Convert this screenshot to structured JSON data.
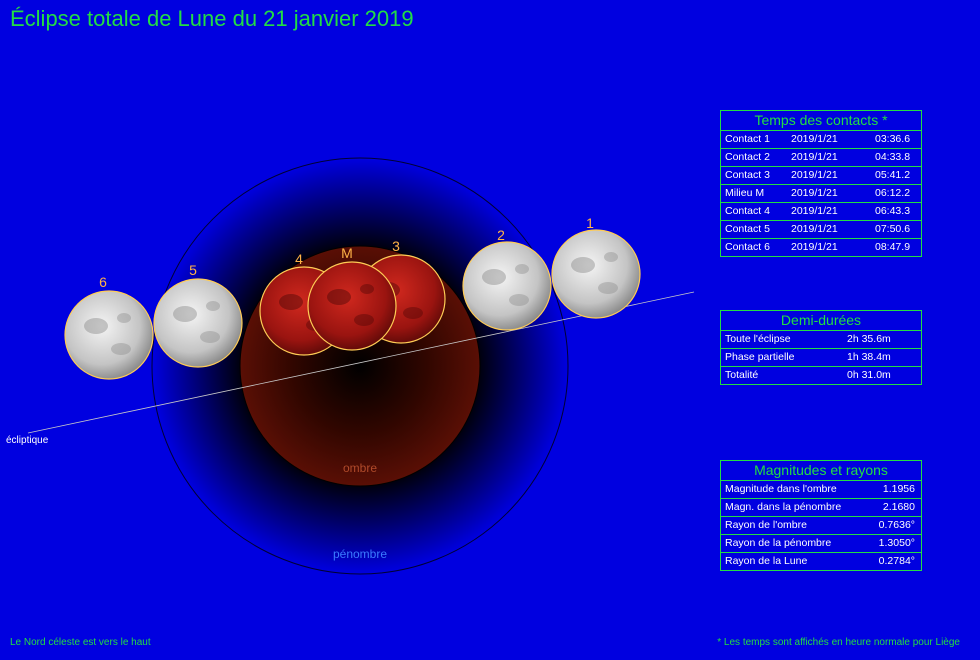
{
  "title": "Éclipse totale de Lune du 21 janvier 2019",
  "diagram": {
    "ecliptic_label": "écliptique",
    "umbra_label": "ombre",
    "penumbra_label": "pénombre",
    "moons": [
      {
        "label": "1",
        "phase": "outside"
      },
      {
        "label": "2",
        "phase": "outside"
      },
      {
        "label": "3",
        "phase": "umbra"
      },
      {
        "label": "M",
        "phase": "umbra"
      },
      {
        "label": "4",
        "phase": "umbra"
      },
      {
        "label": "5",
        "phase": "outside"
      },
      {
        "label": "6",
        "phase": "outside"
      }
    ]
  },
  "contacts": {
    "title": "Temps des contacts *",
    "rows": [
      {
        "name": "Contact 1",
        "date": "2019/1/21",
        "time": "03:36.6"
      },
      {
        "name": "Contact 2",
        "date": "2019/1/21",
        "time": "04:33.8"
      },
      {
        "name": "Contact 3",
        "date": "2019/1/21",
        "time": "05:41.2"
      },
      {
        "name": "Milieu M",
        "date": "2019/1/21",
        "time": "06:12.2"
      },
      {
        "name": "Contact 4",
        "date": "2019/1/21",
        "time": "06:43.3"
      },
      {
        "name": "Contact 5",
        "date": "2019/1/21",
        "time": "07:50.6"
      },
      {
        "name": "Contact 6",
        "date": "2019/1/21",
        "time": "08:47.9"
      }
    ]
  },
  "durations": {
    "title": "Demi-durées",
    "rows": [
      {
        "name": "Toute l'éclipse",
        "value": "2h 35.6m"
      },
      {
        "name": "Phase partielle",
        "value": "1h 38.4m"
      },
      {
        "name": "Totalité",
        "value": "0h 31.0m"
      }
    ]
  },
  "magnitudes": {
    "title": "Magnitudes et rayons",
    "rows": [
      {
        "name": "Magnitude dans l'ombre",
        "value": "1.1956"
      },
      {
        "name": "Magn. dans la pénombre",
        "value": "2.1680"
      },
      {
        "name": "Rayon de l'ombre",
        "value": "0.7636°"
      },
      {
        "name": "Rayon de la pénombre",
        "value": "1.3050°"
      },
      {
        "name": "Rayon de la Lune",
        "value": "0.2784°"
      }
    ]
  },
  "footer": {
    "left": "Le Nord céleste est vers le haut",
    "right": "* Les temps sont affichés en heure normale pour Liège"
  },
  "colors": {
    "background": "#0000e0",
    "accent": "#22dd44",
    "umbra": "#5a0f05",
    "moon_outline": "#ffcc55"
  }
}
